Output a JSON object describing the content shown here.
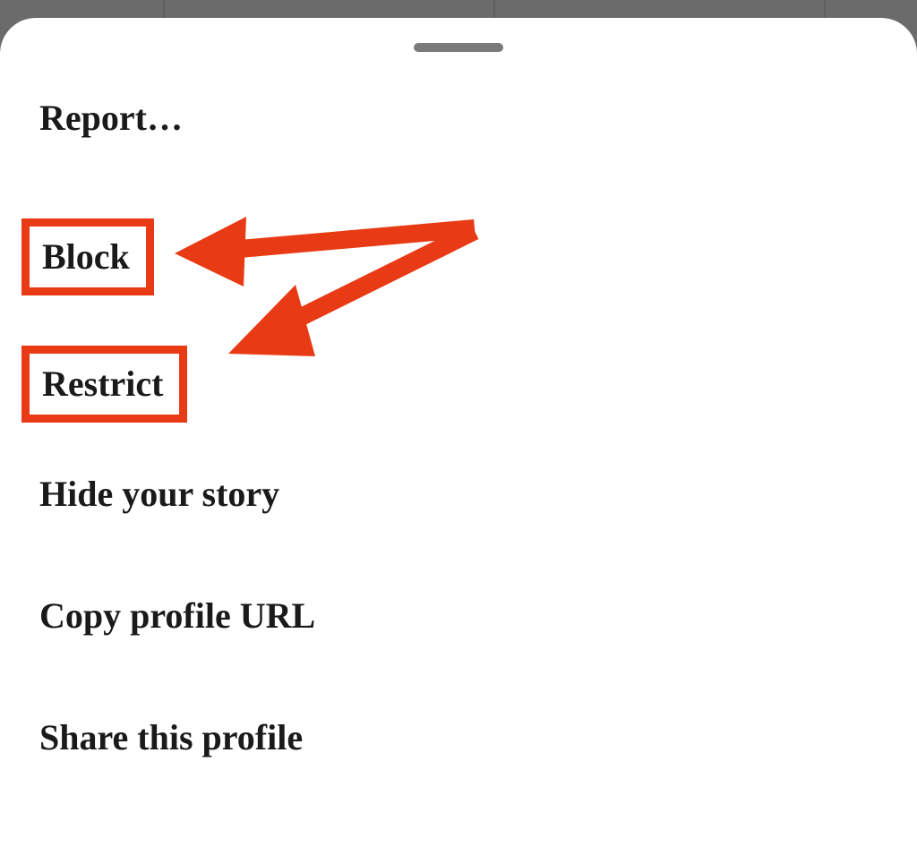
{
  "menu": {
    "items": [
      {
        "label": "Report…",
        "highlighted": false
      },
      {
        "label": "Block",
        "highlighted": true
      },
      {
        "label": "Restrict",
        "highlighted": true
      },
      {
        "label": "Hide your story",
        "highlighted": false
      },
      {
        "label": "Copy profile URL",
        "highlighted": false
      },
      {
        "label": "Share this profile",
        "highlighted": false
      }
    ]
  },
  "annotation": {
    "color": "#e83b15"
  }
}
